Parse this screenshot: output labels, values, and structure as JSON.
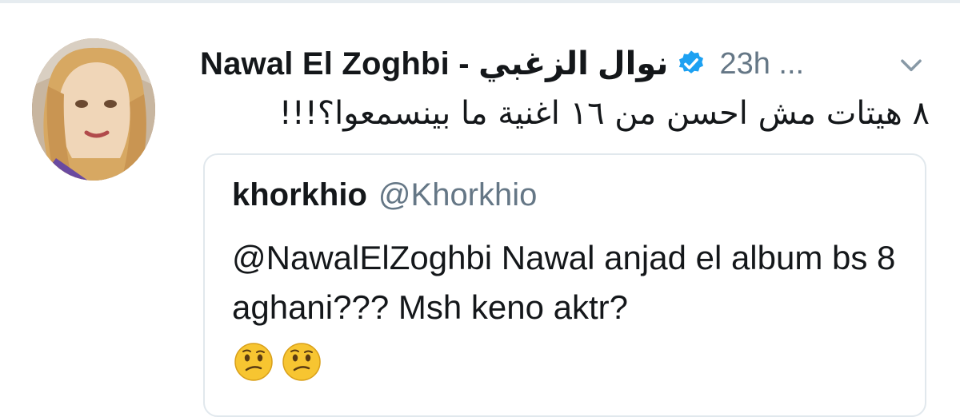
{
  "tweet": {
    "display_name": "Nawal El Zoghbi - نوال الزغبي",
    "meta": "23h ...",
    "text": "٨ هيتات مش احسن من ١٦ اغنية ما بينسمعوا؟!!!",
    "icons": {
      "avatar": "avatar",
      "verified": "verified-badge-icon",
      "menu": "chevron-down-icon"
    },
    "colors": {
      "name": "#14171a",
      "secondary": "#657786",
      "verified": "#1da1f2",
      "border": "#e1e8ed"
    }
  },
  "quoted_tweet": {
    "display_name": "khorkhio",
    "handle": "@Khorkhio",
    "text": "@NawalElZoghbi Nawal anjad el album bs 8 aghani??? Msh keno aktr?",
    "emojis": [
      "confused-face-emoji",
      "confused-face-emoji"
    ]
  }
}
